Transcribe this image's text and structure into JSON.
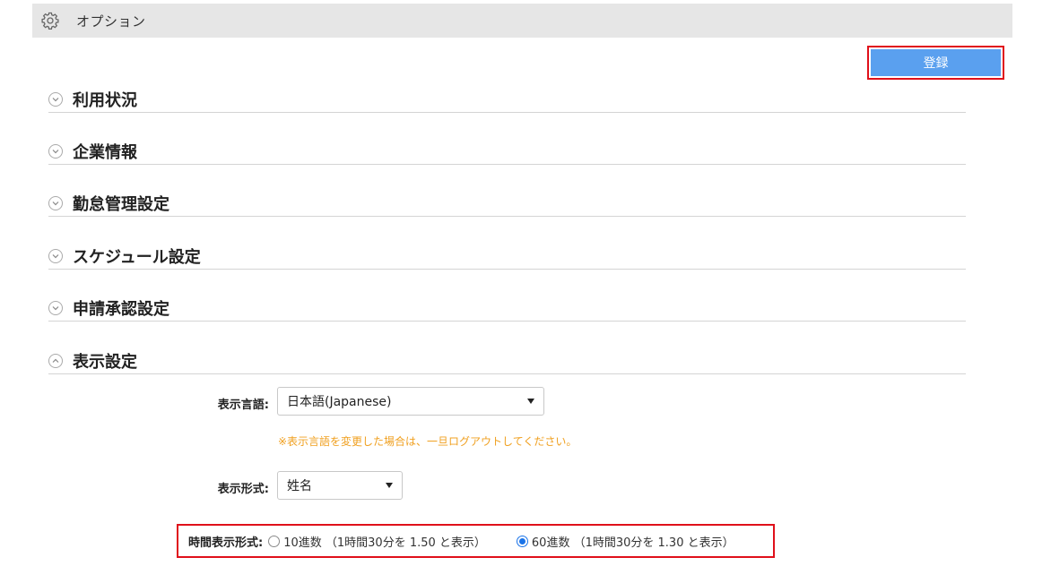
{
  "header": {
    "title": "オプション",
    "icon": "gear-icon"
  },
  "toolbar": {
    "register_label": "登録",
    "accent": "#5aa0ef"
  },
  "sections": [
    {
      "label": "利用状況",
      "state": "collapsed"
    },
    {
      "label": "企業情報",
      "state": "collapsed"
    },
    {
      "label": "勤怠管理設定",
      "state": "collapsed"
    },
    {
      "label": "スケジュール設定",
      "state": "collapsed"
    },
    {
      "label": "申請承認設定",
      "state": "collapsed"
    },
    {
      "label": "表示設定",
      "state": "expanded"
    }
  ],
  "display_settings": {
    "language": {
      "label": "表示言語:",
      "value": "日本語(Japanese)"
    },
    "language_note": "※表示言語を変更した場合は、一旦ログアウトしてください。",
    "name_format": {
      "label": "表示形式:",
      "value": "姓名"
    },
    "time_format": {
      "label": "時間表示形式:",
      "options": [
        {
          "label": "10進数 （1時間30分を 1.50 と表示）",
          "checked": false
        },
        {
          "label": "60進数 （1時間30分を 1.30 と表示）",
          "checked": true
        }
      ]
    }
  },
  "colors": {
    "highlight_border": "#e0101a",
    "note": "#f0a020"
  }
}
